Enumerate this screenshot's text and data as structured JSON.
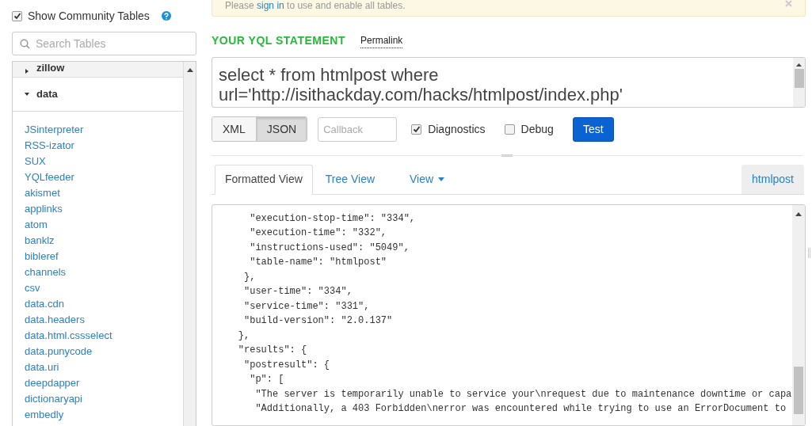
{
  "sidebar": {
    "show_community": {
      "label": "Show Community Tables",
      "checked": true
    },
    "search": {
      "placeholder": "Search Tables"
    },
    "groups": [
      {
        "label": "zillow",
        "expanded": false
      },
      {
        "label": "data",
        "expanded": true,
        "items": [
          "JSinterpreter",
          "RSS-izator",
          "SUX",
          "YQLfeeder",
          "akismet",
          "applinks",
          "atom",
          "banklz",
          "bibleref",
          "channels",
          "csv",
          "data.cdn",
          "data.headers",
          "data.html.cssselect",
          "data.punycode",
          "data.uri",
          "deepdapper",
          "dictionaryapi",
          "embedly"
        ]
      }
    ]
  },
  "notice": {
    "text": "Please ",
    "link": "sign in",
    "rest": " to use and enable all tables."
  },
  "statement": {
    "heading": "YOUR YQL STATEMENT",
    "permalink": "Permalink",
    "lines": [
      "select * from htmlpost where",
      "url='http://isithackday.com/hacks/htmlpost/index.php'"
    ]
  },
  "formats": [
    {
      "label": "XML",
      "selected": false
    },
    {
      "label": "JSON",
      "selected": true
    }
  ],
  "callback": {
    "placeholder": "Callback"
  },
  "options": [
    {
      "label": "Diagnostics",
      "checked": true
    },
    {
      "label": "Debug",
      "checked": false
    }
  ],
  "test_button": "Test",
  "tabs": [
    {
      "label": "Formatted View",
      "selected": true,
      "kind": "tab"
    },
    {
      "label": "Tree View",
      "selected": false,
      "kind": "tab"
    },
    {
      "label": "View",
      "selected": false,
      "kind": "dropdown"
    }
  ],
  "table_tag": "htmlpost",
  "code_lines": [
    "      \"execution-stop-time\": \"334\",",
    "      \"execution-time\": \"332\",",
    "      \"instructions-used\": \"5049\",",
    "      \"table-name\": \"htmlpost\"",
    "     },",
    "     \"user-time\": \"334\",",
    "     \"service-time\": \"331\",",
    "     \"build-version\": \"2.0.137\"",
    "    },",
    "    \"results\": {",
    "     \"postresult\": {",
    "      \"p\": [",
    "       \"The server is temporarily unable to service your\\nrequest due to maintenance downtime or capa",
    "       \"Additionally, a 403 Forbidden\\nerror was encountered while trying to use an ErrorDocument to"
  ]
}
